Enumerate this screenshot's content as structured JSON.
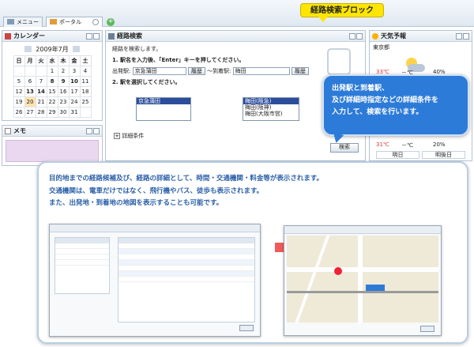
{
  "tabs": [
    {
      "label": "メニュー"
    },
    {
      "label": "ポータル"
    }
  ],
  "callout_top": "経路検索ブロック",
  "calendar": {
    "title": "カレンダー",
    "month_label": "2009年7月",
    "weekdays": [
      "日",
      "月",
      "火",
      "水",
      "木",
      "金",
      "土"
    ],
    "weeks": [
      [
        "",
        "",
        "",
        "1",
        "2",
        "3",
        "4"
      ],
      [
        "5",
        "6",
        "7",
        "8",
        "9",
        "10",
        "11"
      ],
      [
        "12",
        "13",
        "14",
        "15",
        "16",
        "17",
        "18"
      ],
      [
        "19",
        "20",
        "21",
        "22",
        "23",
        "24",
        "25"
      ],
      [
        "26",
        "27",
        "28",
        "29",
        "30",
        "31",
        ""
      ]
    ]
  },
  "memo": {
    "title": "メモ"
  },
  "route": {
    "title": "経路検索",
    "intro": "経路を検索します。",
    "step1": "1. 駅名を入力後、「Enter」キーを押してください。",
    "from_label": "出発駅:",
    "from_value": "京急蒲田",
    "history_label": "履歴",
    "to_label": "～到着駅:",
    "to_value": "梅田",
    "step2": "2. 駅を選択してください。",
    "from_options": [
      "京急蒲田"
    ],
    "to_options": [
      "梅田(阪急)",
      "梅田(阪神)",
      "梅田(大阪市営)"
    ],
    "detail_label": "詳細条件",
    "search_label": "検索"
  },
  "weather": {
    "title": "天気予報",
    "city": "東京都",
    "high1": "33℃",
    "low1": "－℃",
    "pct1": "40%",
    "high2": "31℃",
    "low2": "－℃",
    "pct2": "20%",
    "day1": "明日",
    "day2": "明後日"
  },
  "balloon": {
    "line1": "出発駅と到着駅、",
    "line2": "及び詳細時指定などの詳細条件を",
    "line3": "入力して、検索を行います。"
  },
  "info": {
    "line1": "目的地までの経路候補及び、経路の詳細として、時間・交通機関・料金等が表示されます。",
    "line2": "交通機関は、電車だけではなく、飛行機やバス、徒歩も表示されます。",
    "line3": "また、出発地・到着地の地図を表示することも可能です。"
  },
  "colors": {
    "accent_blue": "#2d7bd8",
    "callout_yellow": "#ffe600",
    "arrow_red": "#f05a5a",
    "info_text": "#2a5fa8"
  }
}
